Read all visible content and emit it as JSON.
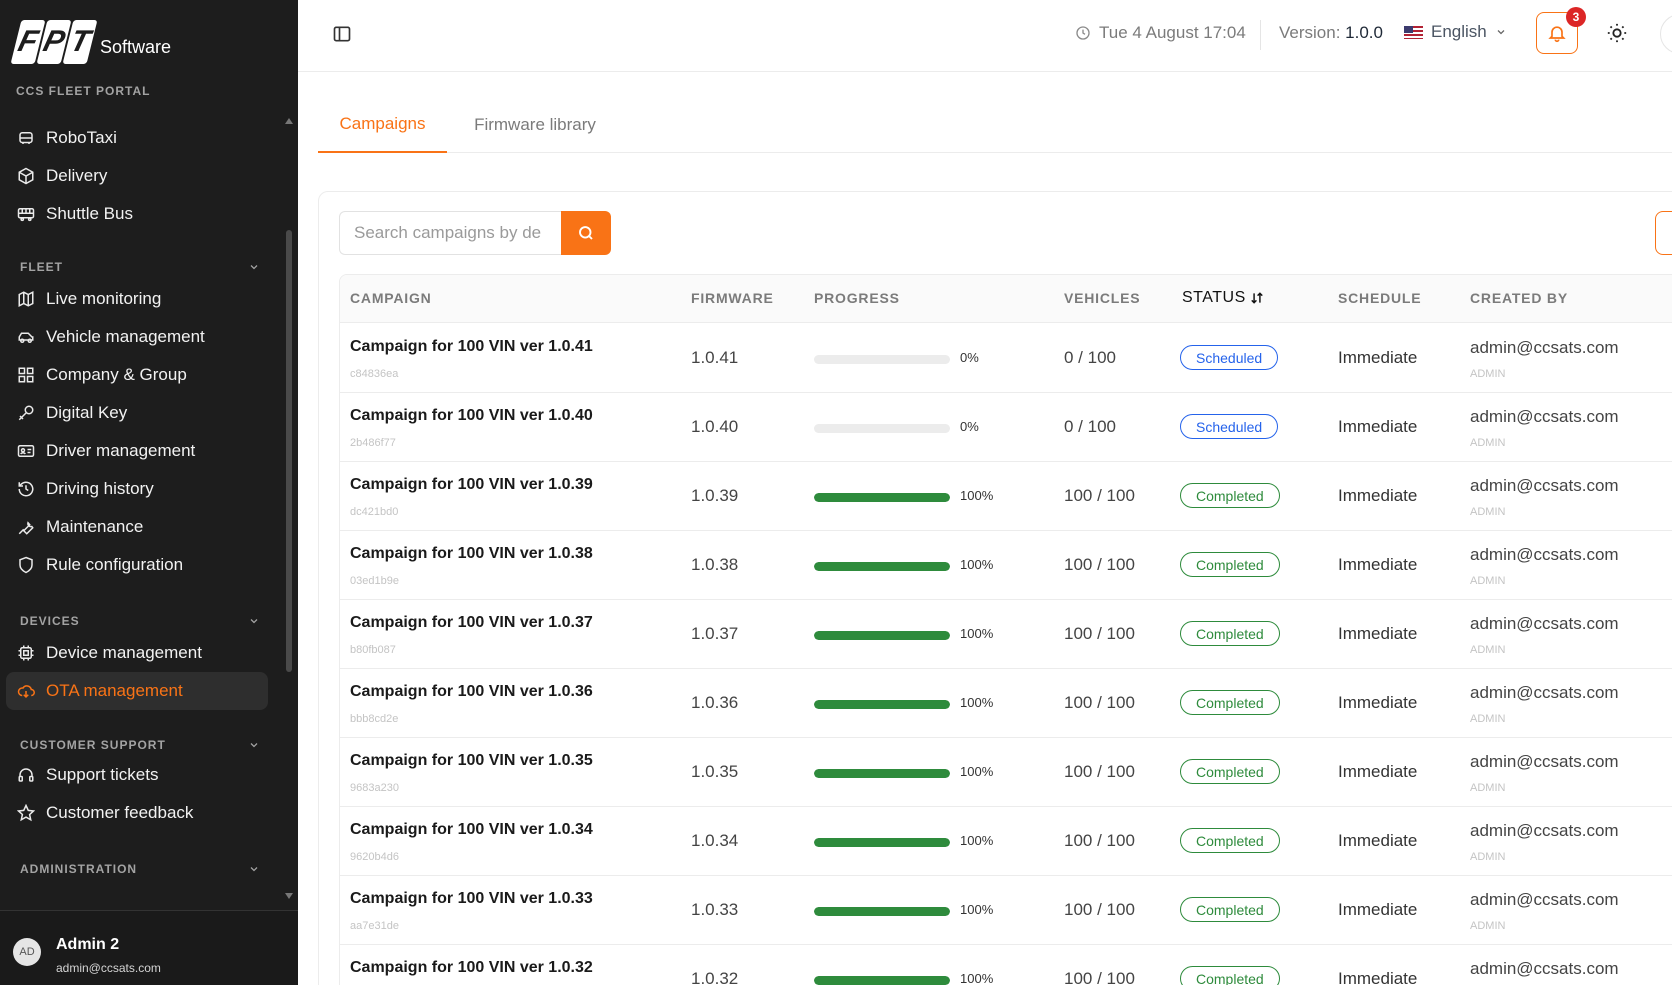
{
  "brand": {
    "logo_letters": [
      "F",
      "P",
      "T"
    ],
    "logo_text": "Software",
    "portal_label": "CCS FLEET PORTAL"
  },
  "sidebar": {
    "top_items": [
      {
        "label": "RoboTaxi",
        "icon": "car-icon"
      },
      {
        "label": "Delivery",
        "icon": "package-icon"
      },
      {
        "label": "Shuttle Bus",
        "icon": "bus-icon"
      }
    ],
    "fleet_label": "FLEET",
    "fleet_items": [
      {
        "label": "Live monitoring",
        "icon": "map-icon"
      },
      {
        "label": "Vehicle management",
        "icon": "car-side-icon"
      },
      {
        "label": "Company & Group",
        "icon": "grid-icon"
      },
      {
        "label": "Digital Key",
        "icon": "key-icon"
      },
      {
        "label": "Driver management",
        "icon": "id-card-icon"
      },
      {
        "label": "Driving history",
        "icon": "history-icon"
      },
      {
        "label": "Maintenance",
        "icon": "wrench-icon"
      },
      {
        "label": "Rule configuration",
        "icon": "shield-icon"
      }
    ],
    "devices_label": "DEVICES",
    "devices_items": [
      {
        "label": "Device management",
        "icon": "chip-icon"
      },
      {
        "label": "OTA management",
        "icon": "cloud-download-icon",
        "active": true
      }
    ],
    "support_label": "CUSTOMER SUPPORT",
    "support_items": [
      {
        "label": "Support tickets",
        "icon": "headset-icon"
      },
      {
        "label": "Customer feedback",
        "icon": "star-icon"
      }
    ],
    "admin_label": "ADMINISTRATION"
  },
  "user": {
    "initials": "AD",
    "name": "Admin 2",
    "email": "admin@ccsats.com"
  },
  "header": {
    "datetime": "Tue 4 August 17:04",
    "version_label": "Version:",
    "version_value": "1.0.0",
    "language": "English",
    "notification_count": "3"
  },
  "tabs": [
    {
      "label": "Campaigns",
      "active": true
    },
    {
      "label": "Firmware library"
    }
  ],
  "search": {
    "placeholder": "Search campaigns by de"
  },
  "table": {
    "columns": {
      "campaign": "CAMPAIGN",
      "firmware": "FIRMWARE",
      "progress": "PROGRESS",
      "vehicles": "VEHICLES",
      "status": "STATUS",
      "schedule": "SCHEDULE",
      "created_by": "CREATED BY"
    },
    "rows": [
      {
        "name": "Campaign for 100 VIN ver 1.0.41",
        "id": "c84836ea",
        "firmware": "1.0.41",
        "progress": 0,
        "progress_label": "0%",
        "vehicles": "0 / 100",
        "status": "Scheduled",
        "schedule": "Immediate",
        "created_by": "admin@ccsats.com",
        "role": "ADMIN"
      },
      {
        "name": "Campaign for 100 VIN ver 1.0.40",
        "id": "2b486f77",
        "firmware": "1.0.40",
        "progress": 0,
        "progress_label": "0%",
        "vehicles": "0 / 100",
        "status": "Scheduled",
        "schedule": "Immediate",
        "created_by": "admin@ccsats.com",
        "role": "ADMIN"
      },
      {
        "name": "Campaign for 100 VIN ver 1.0.39",
        "id": "dc421bd0",
        "firmware": "1.0.39",
        "progress": 100,
        "progress_label": "100%",
        "vehicles": "100 / 100",
        "status": "Completed",
        "schedule": "Immediate",
        "created_by": "admin@ccsats.com",
        "role": "ADMIN"
      },
      {
        "name": "Campaign for 100 VIN ver 1.0.38",
        "id": "03ed1b9e",
        "firmware": "1.0.38",
        "progress": 100,
        "progress_label": "100%",
        "vehicles": "100 / 100",
        "status": "Completed",
        "schedule": "Immediate",
        "created_by": "admin@ccsats.com",
        "role": "ADMIN"
      },
      {
        "name": "Campaign for 100 VIN ver 1.0.37",
        "id": "b80fb087",
        "firmware": "1.0.37",
        "progress": 100,
        "progress_label": "100%",
        "vehicles": "100 / 100",
        "status": "Completed",
        "schedule": "Immediate",
        "created_by": "admin@ccsats.com",
        "role": "ADMIN"
      },
      {
        "name": "Campaign for 100 VIN ver 1.0.36",
        "id": "bbb8cd2e",
        "firmware": "1.0.36",
        "progress": 100,
        "progress_label": "100%",
        "vehicles": "100 / 100",
        "status": "Completed",
        "schedule": "Immediate",
        "created_by": "admin@ccsats.com",
        "role": "ADMIN"
      },
      {
        "name": "Campaign for 100 VIN ver 1.0.35",
        "id": "9683a230",
        "firmware": "1.0.35",
        "progress": 100,
        "progress_label": "100%",
        "vehicles": "100 / 100",
        "status": "Completed",
        "schedule": "Immediate",
        "created_by": "admin@ccsats.com",
        "role": "ADMIN"
      },
      {
        "name": "Campaign for 100 VIN ver 1.0.34",
        "id": "9620b4d6",
        "firmware": "1.0.34",
        "progress": 100,
        "progress_label": "100%",
        "vehicles": "100 / 100",
        "status": "Completed",
        "schedule": "Immediate",
        "created_by": "admin@ccsats.com",
        "role": "ADMIN"
      },
      {
        "name": "Campaign for 100 VIN ver 1.0.33",
        "id": "aa7e31de",
        "firmware": "1.0.33",
        "progress": 100,
        "progress_label": "100%",
        "vehicles": "100 / 100",
        "status": "Completed",
        "schedule": "Immediate",
        "created_by": "admin@ccsats.com",
        "role": "ADMIN"
      },
      {
        "name": "Campaign for 100 VIN ver 1.0.32",
        "id": "",
        "firmware": "1.0.32",
        "progress": 100,
        "progress_label": "100%",
        "vehicles": "100 / 100",
        "status": "Completed",
        "schedule": "Immediate",
        "created_by": "admin@ccsats.com",
        "role": ""
      }
    ]
  },
  "colors": {
    "accent": "#f97316",
    "sidebar_bg": "#1d1d1d",
    "progress_fill": "#2e8b3c",
    "scheduled": "#2563eb",
    "completed": "#2e8b3c",
    "badge_red": "#dc2626"
  }
}
